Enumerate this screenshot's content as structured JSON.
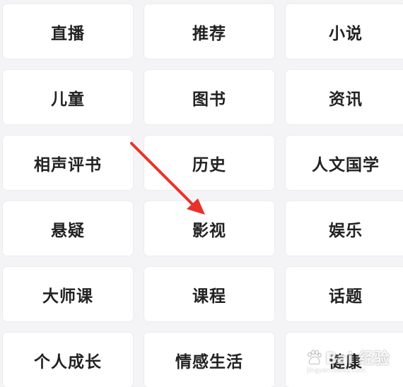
{
  "categories": [
    [
      "直播",
      "推荐",
      "小说"
    ],
    [
      "儿童",
      "图书",
      "资讯"
    ],
    [
      "相声评书",
      "历史",
      "人文国学"
    ],
    [
      "悬疑",
      "影视",
      "娱乐"
    ],
    [
      "大师课",
      "课程",
      "话题"
    ],
    [
      "个人成长",
      "情感生活",
      "健康"
    ]
  ],
  "annotation": {
    "arrow_color": "#e8322b"
  },
  "watermark": {
    "text": "Bai 经验",
    "url": "jingyan.baidu.com"
  }
}
